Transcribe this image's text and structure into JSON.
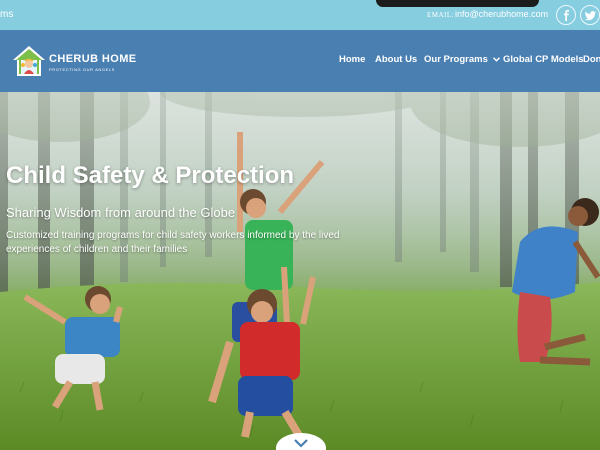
{
  "topbar": {
    "left_text": "ms",
    "email_label": "EMAIL:",
    "email_value": "info@cherubhome.com",
    "social": [
      {
        "icon": "facebook-icon"
      },
      {
        "icon": "twitter-icon"
      }
    ]
  },
  "header": {
    "brand_name": "CHERUB HOME",
    "brand_tagline": "PROTECTING OUR ANGELS",
    "nav": [
      {
        "label": "Home"
      },
      {
        "label": "About Us"
      },
      {
        "label": "Our Programs",
        "icon": "chevron-down-icon"
      },
      {
        "label": "Global CP Models"
      },
      {
        "label": "Donat"
      }
    ]
  },
  "hero": {
    "title": "Child Safety & Protection",
    "subtitle": "Sharing Wisdom from around the Globe",
    "description": "Customized training programs for child safety workers informed by the lived experiences of children and their families",
    "scroll_icon": "chevron-down-icon"
  },
  "colors": {
    "topbar_bg": "#86cde0",
    "header_bg": "#4a7fb2",
    "text": "#ffffff"
  }
}
